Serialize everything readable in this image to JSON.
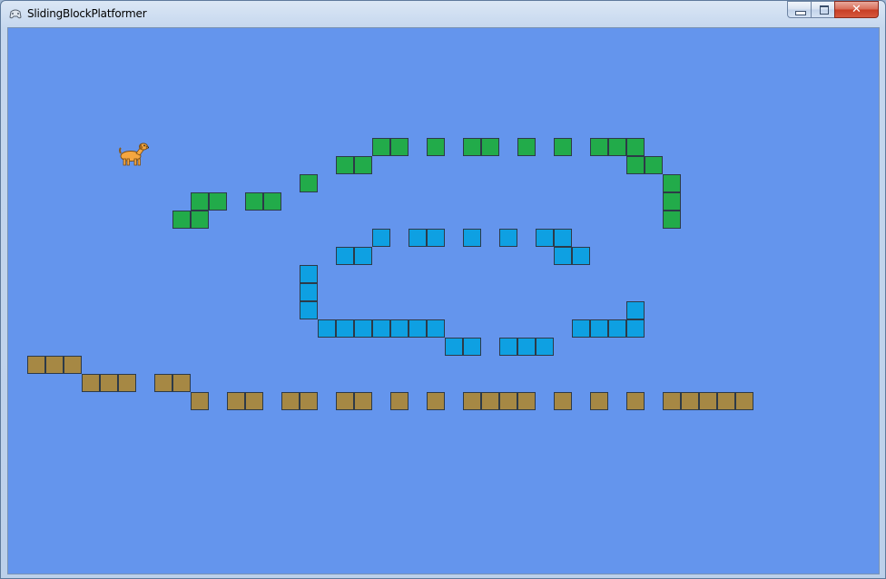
{
  "window": {
    "title": "SlidingBlockPlatformer",
    "app_icon": "controller-icon",
    "controls": {
      "minimize_icon": "minimize-icon",
      "maximize_icon": "maximize-icon",
      "close_label": "✕"
    }
  },
  "game": {
    "background_color": "#6495ed",
    "player": {
      "sprite": "dog-icon",
      "color": "#f4a640"
    },
    "block_colors": {
      "green": "#22ab4a",
      "blue": "#0ea0e2",
      "brown": "#a68844"
    },
    "blocks": {
      "green": [
        [
          20,
          6
        ],
        [
          21,
          6
        ],
        [
          23,
          6
        ],
        [
          25,
          6
        ],
        [
          26,
          6
        ],
        [
          28,
          6
        ],
        [
          30,
          6
        ],
        [
          32,
          6
        ],
        [
          33,
          6
        ],
        [
          34,
          6
        ],
        [
          18,
          7
        ],
        [
          19,
          7
        ],
        [
          34,
          7
        ],
        [
          35,
          7
        ],
        [
          16,
          8
        ],
        [
          36,
          8
        ],
        [
          10,
          9
        ],
        [
          11,
          9
        ],
        [
          13,
          9
        ],
        [
          14,
          9
        ],
        [
          36,
          9
        ],
        [
          9,
          10
        ],
        [
          10,
          10
        ],
        [
          36,
          10
        ]
      ],
      "blue": [
        [
          20,
          11
        ],
        [
          22,
          11
        ],
        [
          23,
          11
        ],
        [
          25,
          11
        ],
        [
          27,
          11
        ],
        [
          29,
          11
        ],
        [
          30,
          11
        ],
        [
          18,
          12
        ],
        [
          19,
          12
        ],
        [
          30,
          12
        ],
        [
          31,
          12
        ],
        [
          16,
          13
        ],
        [
          16,
          14
        ],
        [
          16,
          15
        ],
        [
          34,
          15
        ],
        [
          17,
          16
        ],
        [
          18,
          16
        ],
        [
          19,
          16
        ],
        [
          20,
          16
        ],
        [
          21,
          16
        ],
        [
          22,
          16
        ],
        [
          23,
          16
        ],
        [
          31,
          16
        ],
        [
          32,
          16
        ],
        [
          33,
          16
        ],
        [
          34,
          16
        ],
        [
          24,
          17
        ],
        [
          25,
          17
        ],
        [
          27,
          17
        ],
        [
          28,
          17
        ],
        [
          29,
          17
        ]
      ],
      "brown": [
        [
          1,
          18
        ],
        [
          2,
          18
        ],
        [
          3,
          18
        ],
        [
          4,
          19
        ],
        [
          5,
          19
        ],
        [
          6,
          19
        ],
        [
          8,
          19
        ],
        [
          9,
          19
        ],
        [
          10,
          20
        ],
        [
          12,
          20
        ],
        [
          13,
          20
        ],
        [
          15,
          20
        ],
        [
          16,
          20
        ],
        [
          18,
          20
        ],
        [
          19,
          20
        ],
        [
          21,
          20
        ],
        [
          23,
          20
        ],
        [
          25,
          20
        ],
        [
          26,
          20
        ],
        [
          27,
          20
        ],
        [
          28,
          20
        ],
        [
          30,
          20
        ],
        [
          32,
          20
        ],
        [
          34,
          20
        ],
        [
          36,
          20
        ],
        [
          37,
          20
        ],
        [
          38,
          20
        ],
        [
          39,
          20
        ],
        [
          40,
          20
        ]
      ]
    }
  }
}
